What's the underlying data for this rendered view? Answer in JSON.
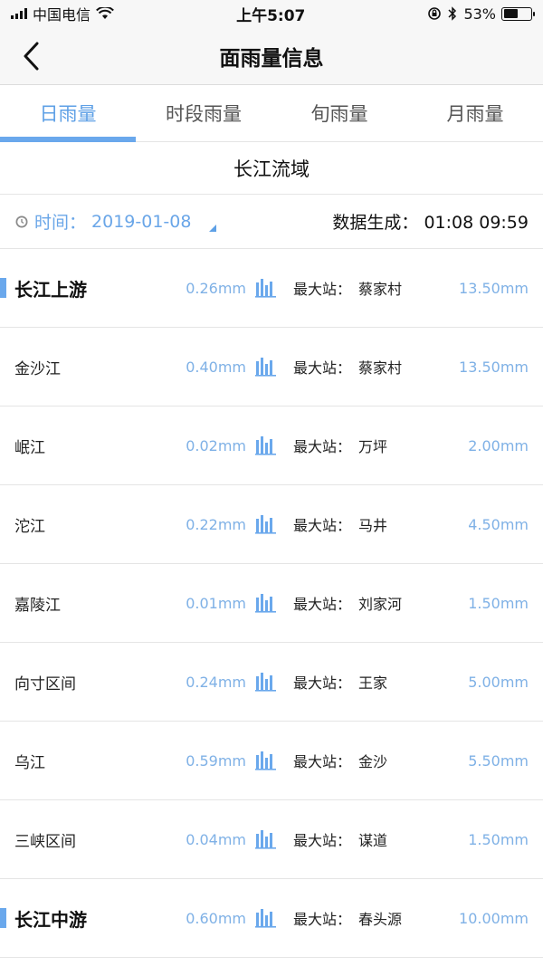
{
  "status_bar": {
    "carrier": "中国电信",
    "time": "上午5:07",
    "battery": "53%"
  },
  "nav": {
    "title": "面雨量信息"
  },
  "tabs": [
    {
      "label": "日雨量",
      "active": true
    },
    {
      "label": "时段雨量",
      "active": false
    },
    {
      "label": "旬雨量",
      "active": false
    },
    {
      "label": "月雨量",
      "active": false
    }
  ],
  "region": "长江流域",
  "time_row": {
    "label": "时间：",
    "date": "2019-01-08",
    "generated_label": "数据生成：",
    "generated_value": "01:08 09:59"
  },
  "max_station_label": "最大站：",
  "rows": [
    {
      "name": "长江上游",
      "group": true,
      "avg": "0.26mm",
      "station": "蔡家村",
      "max": "13.50mm"
    },
    {
      "name": "金沙江",
      "group": false,
      "avg": "0.40mm",
      "station": "蔡家村",
      "max": "13.50mm"
    },
    {
      "name": "岷江",
      "group": false,
      "avg": "0.02mm",
      "station": "万坪",
      "max": "2.00mm"
    },
    {
      "name": "沱江",
      "group": false,
      "avg": "0.22mm",
      "station": "马井",
      "max": "4.50mm"
    },
    {
      "name": "嘉陵江",
      "group": false,
      "avg": "0.01mm",
      "station": "刘家河",
      "max": "1.50mm"
    },
    {
      "name": "向寸区间",
      "group": false,
      "avg": "0.24mm",
      "station": "王家",
      "max": "5.00mm"
    },
    {
      "name": "乌江",
      "group": false,
      "avg": "0.59mm",
      "station": "金沙",
      "max": "5.50mm"
    },
    {
      "name": "三峡区间",
      "group": false,
      "avg": "0.04mm",
      "station": "谋道",
      "max": "1.50mm"
    },
    {
      "name": "长江中游",
      "group": true,
      "avg": "0.60mm",
      "station": "春头源",
      "max": "10.00mm"
    }
  ],
  "colors": {
    "accent": "#6aa8ec",
    "value_text": "#7fb1e6"
  }
}
